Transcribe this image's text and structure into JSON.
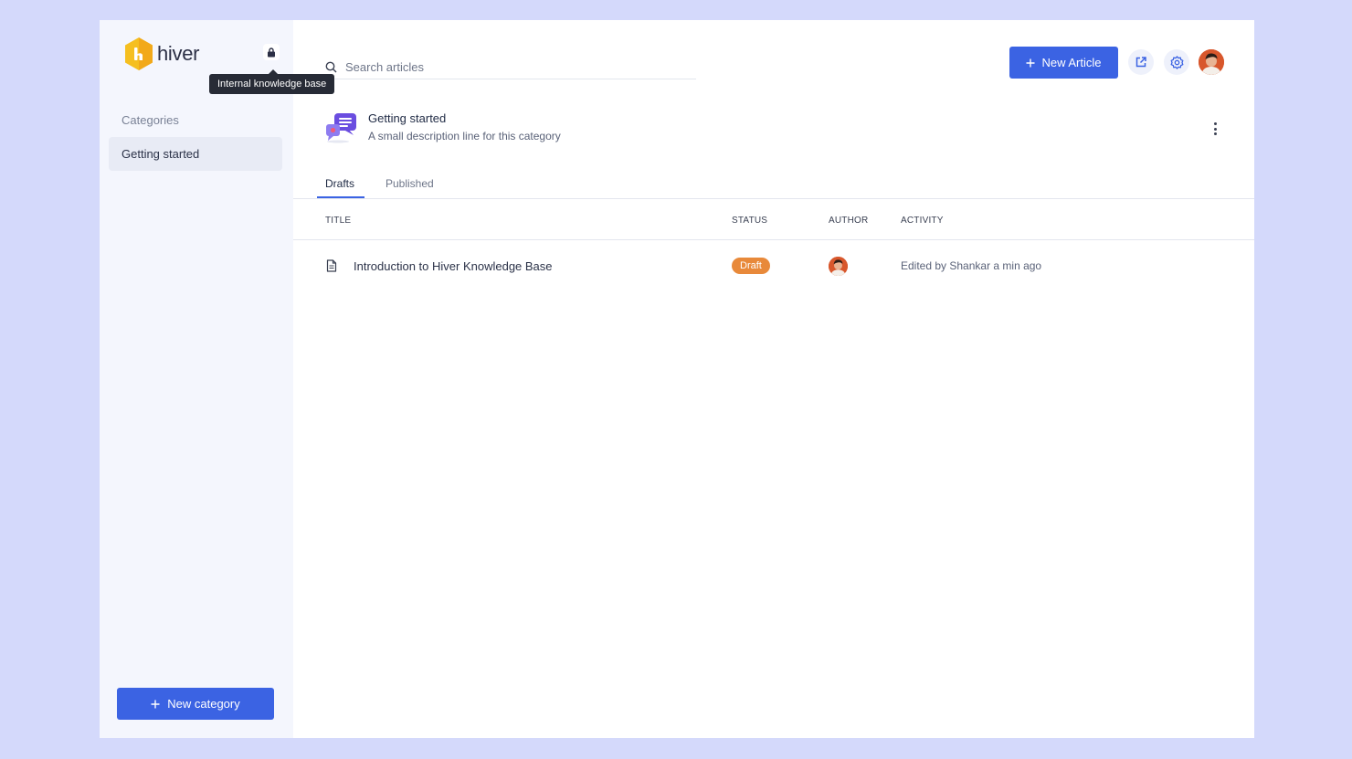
{
  "sidebar": {
    "logo_text": "hiver",
    "lock_tooltip": "Internal knowledge base",
    "categories_label": "Categories",
    "categories": [
      {
        "label": "Getting started",
        "selected": true
      }
    ],
    "new_category_label": "New category"
  },
  "header": {
    "search_placeholder": "Search articles",
    "new_article_label": "New Article"
  },
  "category": {
    "title": "Getting started",
    "description": "A small description line for this category"
  },
  "tabs": [
    {
      "label": "Drafts",
      "active": true
    },
    {
      "label": "Published",
      "active": false
    }
  ],
  "table": {
    "columns": [
      "TITLE",
      "STATUS",
      "AUTHOR",
      "ACTIVITY"
    ],
    "rows": [
      {
        "title": "Introduction to Hiver Knowledge Base",
        "status": "Draft",
        "activity": "Edited by Shankar a min ago"
      }
    ]
  },
  "colors": {
    "accent": "#3b63e3",
    "draft_badge": "#e8893a",
    "logo_yellow": "#f5bf20",
    "page_background": "#d4d9fb"
  },
  "icons": [
    "hiver-logo-icon",
    "lock-icon",
    "search-icon",
    "plus-icon",
    "external-link-icon",
    "gear-icon",
    "user-avatar",
    "category-chat-icon",
    "more-vertical-icon",
    "document-icon"
  ]
}
